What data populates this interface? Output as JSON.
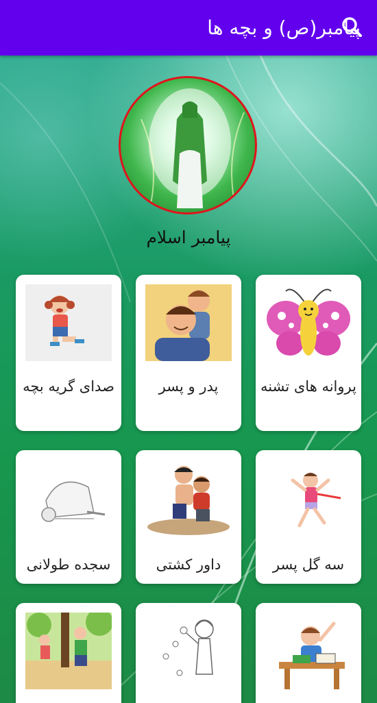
{
  "app_bar": {
    "title": "پیامبر(ص) و بچه ها",
    "color": "#6200ee",
    "search_icon": "search-icon"
  },
  "profile": {
    "name": "پیامبر اسلام",
    "image": "prophet-silhouette-green-light",
    "border_color": "#e0141b"
  },
  "cards": [
    {
      "label": "پروانه های تشنه",
      "image": "butterfly-illustration"
    },
    {
      "label": "پدر و پسر",
      "image": "father-son-illustration"
    },
    {
      "label": "صدای گریه بچه",
      "image": "crying-girl-illustration"
    },
    {
      "label": "سه گل پسر",
      "image": "running-boy-illustration"
    },
    {
      "label": "داور کشتی",
      "image": "wrestling-boys-illustration"
    },
    {
      "label": "سجده طولانی",
      "image": "praying-man-illustration"
    },
    {
      "label": "",
      "image": "student-at-desk-illustration"
    },
    {
      "label": "",
      "image": "coloring-girl-illustration"
    },
    {
      "label": "",
      "image": "children-in-park-illustration"
    }
  ]
}
